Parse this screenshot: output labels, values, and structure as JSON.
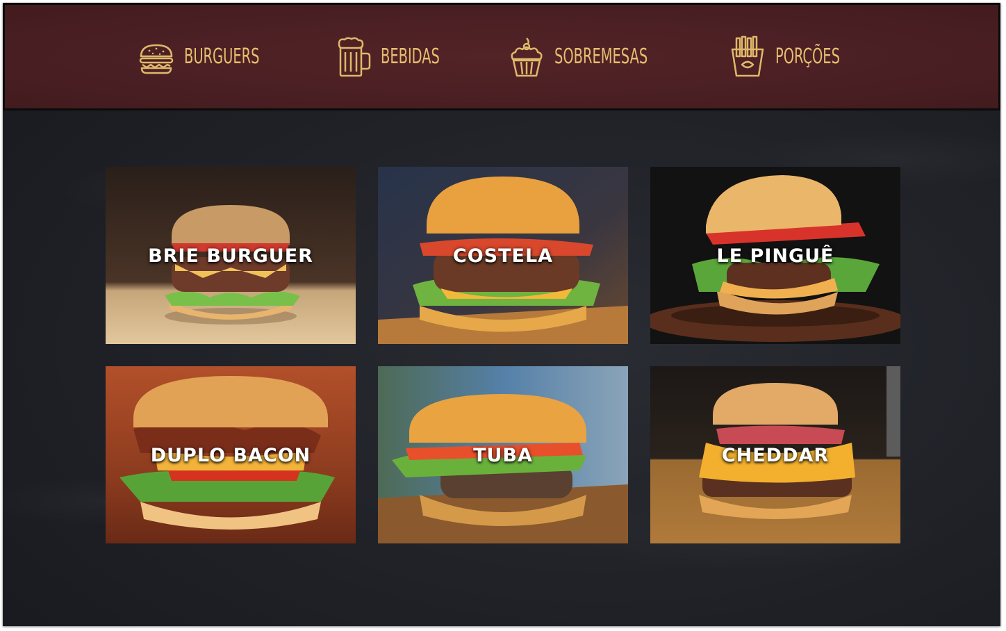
{
  "nav": {
    "items": [
      {
        "label": "BURGUERS",
        "icon": "burger-icon"
      },
      {
        "label": "BEBIDAS",
        "icon": "beer-mug-icon"
      },
      {
        "label": "SOBREMESAS",
        "icon": "cupcake-icon"
      },
      {
        "label": "PORÇÕES",
        "icon": "fries-icon"
      }
    ]
  },
  "colors": {
    "navbar_bg": "#4a1f23",
    "nav_text": "#e6bd70",
    "page_bg": "#1f2127",
    "card_title": "#ffffff"
  },
  "products": [
    {
      "name": "BRIE BURGUER",
      "bg": "#3a2a22"
    },
    {
      "name": "COSTELA",
      "bg": "#2b3242"
    },
    {
      "name": "LE PINGUÊ",
      "bg": "#141414"
    },
    {
      "name": "DUPLO BACON",
      "bg": "#8c3f1f"
    },
    {
      "name": "TUBA",
      "bg": "#4c6a86"
    },
    {
      "name": "CHEDDAR",
      "bg": "#1e1a18"
    }
  ]
}
